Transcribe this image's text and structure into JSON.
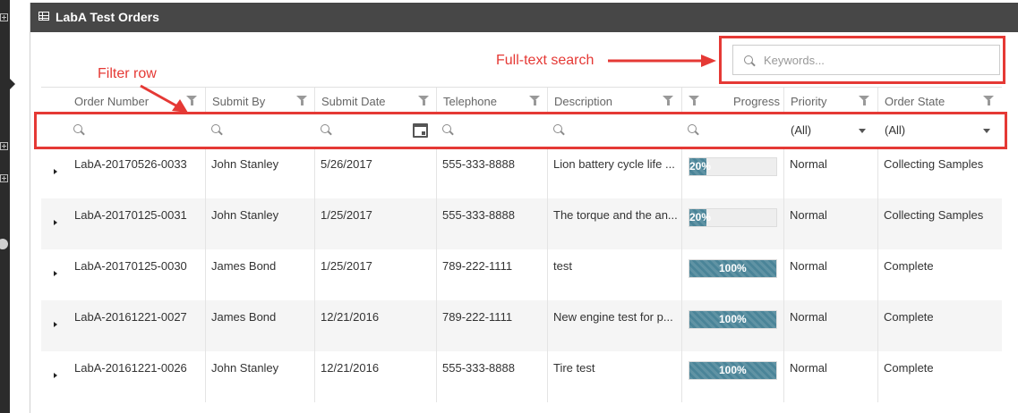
{
  "window": {
    "title": "LabA Test Orders"
  },
  "search": {
    "placeholder": "Keywords..."
  },
  "annotations": {
    "search": "Full-text search",
    "filter": "Filter row"
  },
  "columns": {
    "order_number": "Order Number",
    "submit_by": "Submit By",
    "submit_date": "Submit Date",
    "telephone": "Telephone",
    "description": "Description",
    "progress": "Progress",
    "priority": "Priority",
    "order_state": "Order State"
  },
  "filters": {
    "priority": "(All)",
    "order_state": "(All)"
  },
  "rows": [
    {
      "order": "LabA-20170526-0033",
      "by": "John Stanley",
      "date": "5/26/2017",
      "phone": "555-333-8888",
      "desc": "Lion battery cycle life ...",
      "progress": 20,
      "progress_label": "20%",
      "priority": "Normal",
      "state": "Collecting Samples"
    },
    {
      "order": "LabA-20170125-0031",
      "by": "John Stanley",
      "date": "1/25/2017",
      "phone": "555-333-8888",
      "desc": "The torque and the an...",
      "progress": 20,
      "progress_label": "20%",
      "priority": "Normal",
      "state": "Collecting Samples"
    },
    {
      "order": "LabA-20170125-0030",
      "by": "James Bond",
      "date": "1/25/2017",
      "phone": "789-222-1111",
      "desc": "test",
      "progress": 100,
      "progress_label": "100%",
      "priority": "Normal",
      "state": "Complete"
    },
    {
      "order": "LabA-20161221-0027",
      "by": "James Bond",
      "date": "12/21/2016",
      "phone": "789-222-1111",
      "desc": "New engine test for p...",
      "progress": 100,
      "progress_label": "100%",
      "priority": "Normal",
      "state": "Complete"
    },
    {
      "order": "LabA-20161221-0026",
      "by": "John Stanley",
      "date": "12/21/2016",
      "phone": "555-333-8888",
      "desc": "Tire test",
      "progress": 100,
      "progress_label": "100%",
      "priority": "Normal",
      "state": "Complete"
    }
  ],
  "colors": {
    "accent_red": "#e53935",
    "titlebar": "#474747",
    "progress_fill": "#4a8498"
  }
}
